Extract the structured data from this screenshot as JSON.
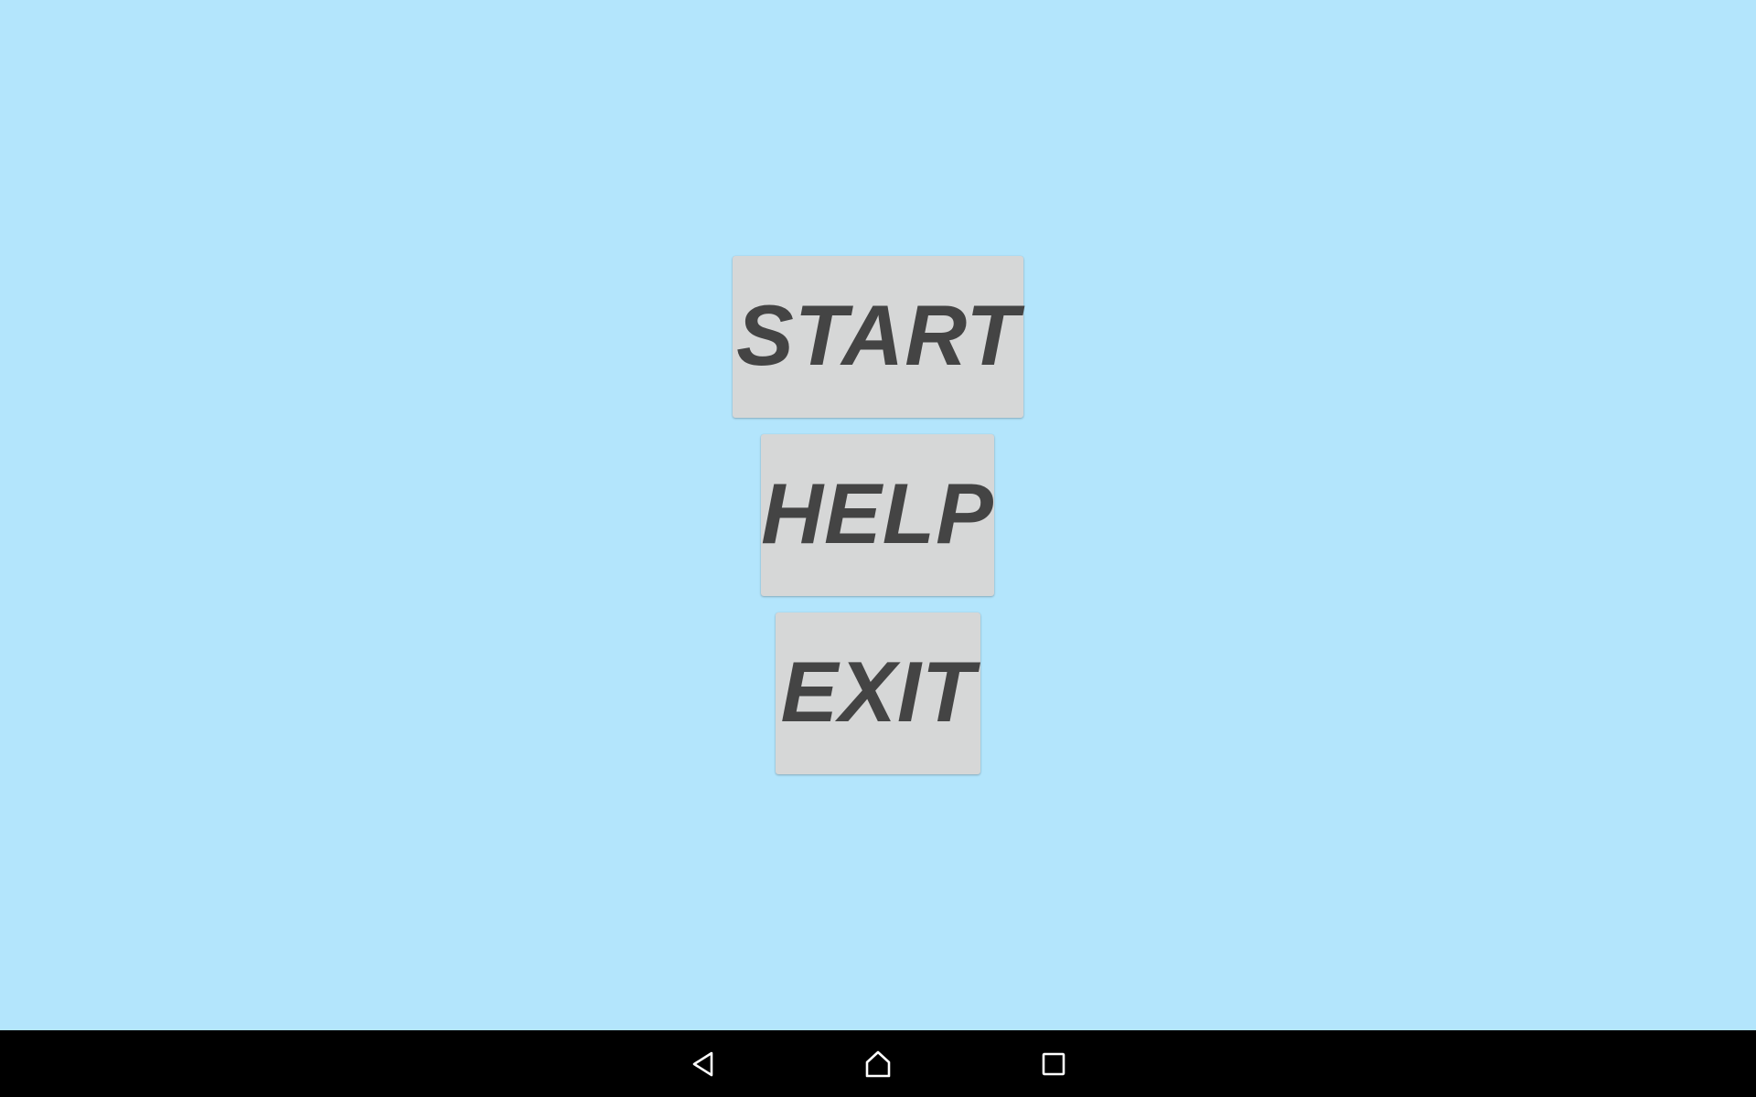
{
  "menu": {
    "start_label": "START",
    "help_label": "HELP",
    "exit_label": "EXIT"
  },
  "navigation_bar": {
    "icons": [
      "back-icon",
      "home-icon",
      "recents-icon"
    ]
  },
  "colors": {
    "background": "#b3e5fc",
    "button_fill": "#d6d7d7",
    "button_text": "#444444",
    "nav_bar": "#000000",
    "nav_icon": "#ffffff"
  }
}
